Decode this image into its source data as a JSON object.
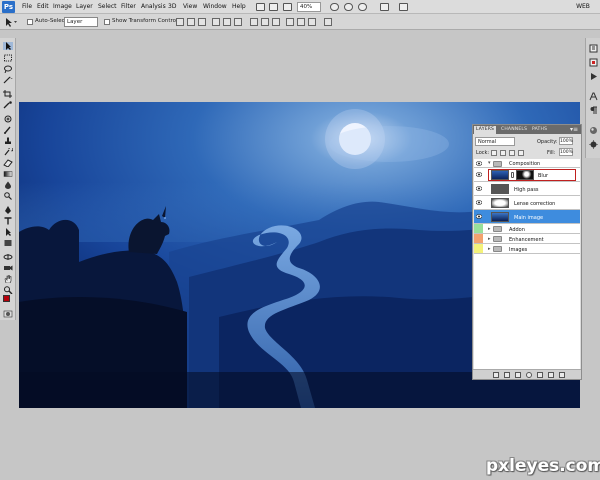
{
  "app": {
    "logo": "Ps",
    "menu": [
      "File",
      "Edit",
      "Image",
      "Layer",
      "Select",
      "Filter",
      "Analysis",
      "3D",
      "View",
      "Window",
      "Help"
    ],
    "zoom": "40%",
    "workspace": "WEB"
  },
  "options": {
    "auto_select_label": "Auto-Select:",
    "auto_select_value": "Layer",
    "transform_label": "Show Transform Controls"
  },
  "layers_panel": {
    "tabs": [
      "LAYERS",
      "CHANNELS",
      "PATHS"
    ],
    "menu_glyph": "▾≡",
    "blend_mode": "Normal",
    "opacity_label": "Opacity:",
    "opacity_value": "100%",
    "lock_label": "Lock:",
    "fill_label": "Fill:",
    "fill_value": "100%",
    "layers": [
      {
        "name": "Composition",
        "kind": "group",
        "expanded": true,
        "label_color": ""
      },
      {
        "name": "Blur",
        "kind": "layer",
        "has_mask": true,
        "highlighted": true
      },
      {
        "name": "High pass",
        "kind": "layer"
      },
      {
        "name": "Lense correction",
        "kind": "layer"
      },
      {
        "name": "Main image",
        "kind": "layer",
        "selected": true
      },
      {
        "name": "Addon",
        "kind": "group",
        "expanded": false,
        "label_color": "#98e09a"
      },
      {
        "name": "Enhancement",
        "kind": "group",
        "expanded": false,
        "label_color": "#f3a26e"
      },
      {
        "name": "Images",
        "kind": "group",
        "expanded": false,
        "label_color": "#f4f27a"
      }
    ]
  },
  "colors": {
    "foreground": "#b4000b",
    "background": "#ffffff",
    "selection": "#3e8cde",
    "highlight_border": "#c0201f"
  },
  "watermark": "pxleyes.com"
}
